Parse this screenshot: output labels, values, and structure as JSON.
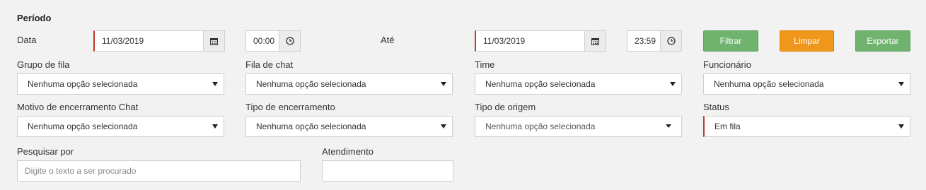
{
  "periodo": {
    "title": "Período",
    "data_label": "Data",
    "ate_label": "Até",
    "start_date": "11/03/2019",
    "start_time": "00:00",
    "end_date": "11/03/2019",
    "end_time": "23:59"
  },
  "buttons": {
    "filtrar": "Filtrar",
    "limpar": "Limpar",
    "exportar": "Exportar"
  },
  "filters": {
    "grupo_fila": {
      "label": "Grupo de fila",
      "value": "Nenhuma opção selecionada"
    },
    "fila_chat": {
      "label": "Fila de chat",
      "value": "Nenhuma opção selecionada"
    },
    "time": {
      "label": "Time",
      "value": "Nenhuma opção selecionada"
    },
    "funcionario": {
      "label": "Funcionário",
      "value": "Nenhuma opção selecionada"
    },
    "motivo": {
      "label": "Motivo de encerramento Chat",
      "value": "Nenhuma opção selecionada"
    },
    "tipo_encerramento": {
      "label": "Tipo de encerramento",
      "value": "Nenhuma opção selecionada"
    },
    "tipo_origem": {
      "label": "Tipo de origem",
      "value": "Nenhuma opção selecionada"
    },
    "status": {
      "label": "Status",
      "value": "Em fila"
    }
  },
  "search": {
    "label": "Pesquisar por",
    "placeholder": "Digite o texto a ser procurado",
    "value": ""
  },
  "atendimento": {
    "label": "Atendimento",
    "value": ""
  },
  "colors": {
    "accent_green": "#6fb36f",
    "accent_orange": "#f0961a",
    "required_marker": "#c0392b"
  }
}
